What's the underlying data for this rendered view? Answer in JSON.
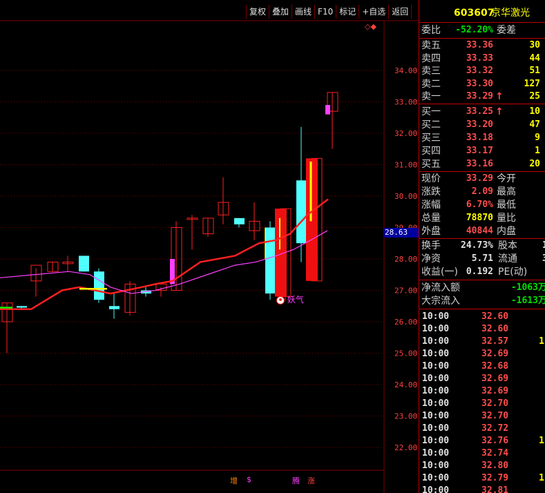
{
  "toolbar": {
    "buttons": [
      "复权",
      "叠加",
      "画线",
      "F10",
      "标记",
      "+自选",
      "返回"
    ]
  },
  "chart": {
    "price_axis": [
      "34.00",
      "33.00",
      "32.00",
      "31.00",
      "30.00",
      "29.00",
      "28.00",
      "27.00",
      "26.00",
      "25.00",
      "24.00",
      "23.00",
      "22.00"
    ],
    "current_price_label": "28.63",
    "annotation_text": "妖气",
    "bottom_markers": [
      "增",
      "$",
      "腾",
      "涨"
    ],
    "diamond_icons": "◇◆",
    "colors": {
      "up": "#ff2020",
      "down": "#50ffff",
      "grid": "#800000",
      "ma_red": "#ff2020",
      "ma_magenta": "#ff40ff",
      "yellow": "#ffff00"
    }
  },
  "quote": {
    "code": "603607",
    "name": "京华激光",
    "weibi_label": "委比",
    "weibi_value": "-52.20%",
    "weicha_label": "委差",
    "asks": [
      {
        "label": "卖五",
        "price": "33.36",
        "vol": "30",
        "arrow": ""
      },
      {
        "label": "卖四",
        "price": "33.33",
        "vol": "44",
        "arrow": ""
      },
      {
        "label": "卖三",
        "price": "33.32",
        "vol": "51",
        "arrow": ""
      },
      {
        "label": "卖二",
        "price": "33.30",
        "vol": "127",
        "arrow": ""
      },
      {
        "label": "卖一",
        "price": "33.29",
        "vol": "25",
        "arrow": "↑"
      }
    ],
    "bids": [
      {
        "label": "买一",
        "price": "33.25",
        "vol": "10",
        "arrow": "↑"
      },
      {
        "label": "买二",
        "price": "33.20",
        "vol": "47",
        "arrow": ""
      },
      {
        "label": "买三",
        "price": "33.18",
        "vol": "9",
        "arrow": ""
      },
      {
        "label": "买四",
        "price": "33.17",
        "vol": "1",
        "arrow": ""
      },
      {
        "label": "买五",
        "price": "33.16",
        "vol": "20",
        "arrow": ""
      }
    ],
    "stats": [
      {
        "label": "现价",
        "value": "33.29",
        "label2": "今开",
        "color": "red"
      },
      {
        "label": "涨跌",
        "value": "2.09",
        "label2": "最高",
        "color": "red"
      },
      {
        "label": "涨幅",
        "value": "6.70%",
        "label2": "最低",
        "color": "red"
      },
      {
        "label": "总量",
        "value": "78870",
        "label2": "量比",
        "color": "yellow"
      },
      {
        "label": "外盘",
        "value": "40844",
        "label2": "内盘",
        "color": "red"
      }
    ],
    "fundamentals": [
      {
        "label": "换手",
        "value": "24.73%",
        "label2": "股本",
        "extra": "1"
      },
      {
        "label": "净资",
        "value": "5.71",
        "label2": "流通",
        "extra": "3"
      },
      {
        "label": "收益(一)",
        "value": "0.192",
        "label2": "PE(动)",
        "extra": ""
      }
    ],
    "flows": [
      {
        "label": "净流入额",
        "value": "-1063万"
      },
      {
        "label": "大宗流入",
        "value": "-1613万"
      }
    ],
    "ticks": [
      {
        "time": "10:00",
        "price": "32.60",
        "vol": ""
      },
      {
        "time": "10:00",
        "price": "32.60",
        "vol": ""
      },
      {
        "time": "10:00",
        "price": "32.57",
        "vol": "1"
      },
      {
        "time": "10:00",
        "price": "32.69",
        "vol": ""
      },
      {
        "time": "10:00",
        "price": "32.68",
        "vol": ""
      },
      {
        "time": "10:00",
        "price": "32.69",
        "vol": ""
      },
      {
        "time": "10:00",
        "price": "32.69",
        "vol": ""
      },
      {
        "time": "10:00",
        "price": "32.70",
        "vol": ""
      },
      {
        "time": "10:00",
        "price": "32.70",
        "vol": ""
      },
      {
        "time": "10:00",
        "price": "32.72",
        "vol": ""
      },
      {
        "time": "10:00",
        "price": "32.76",
        "vol": "1"
      },
      {
        "time": "10:00",
        "price": "32.74",
        "vol": ""
      },
      {
        "time": "10:00",
        "price": "32.80",
        "vol": ""
      },
      {
        "time": "10:00",
        "price": "32.79",
        "vol": "1"
      },
      {
        "time": "10:00",
        "price": "32.81",
        "vol": ""
      }
    ]
  }
}
